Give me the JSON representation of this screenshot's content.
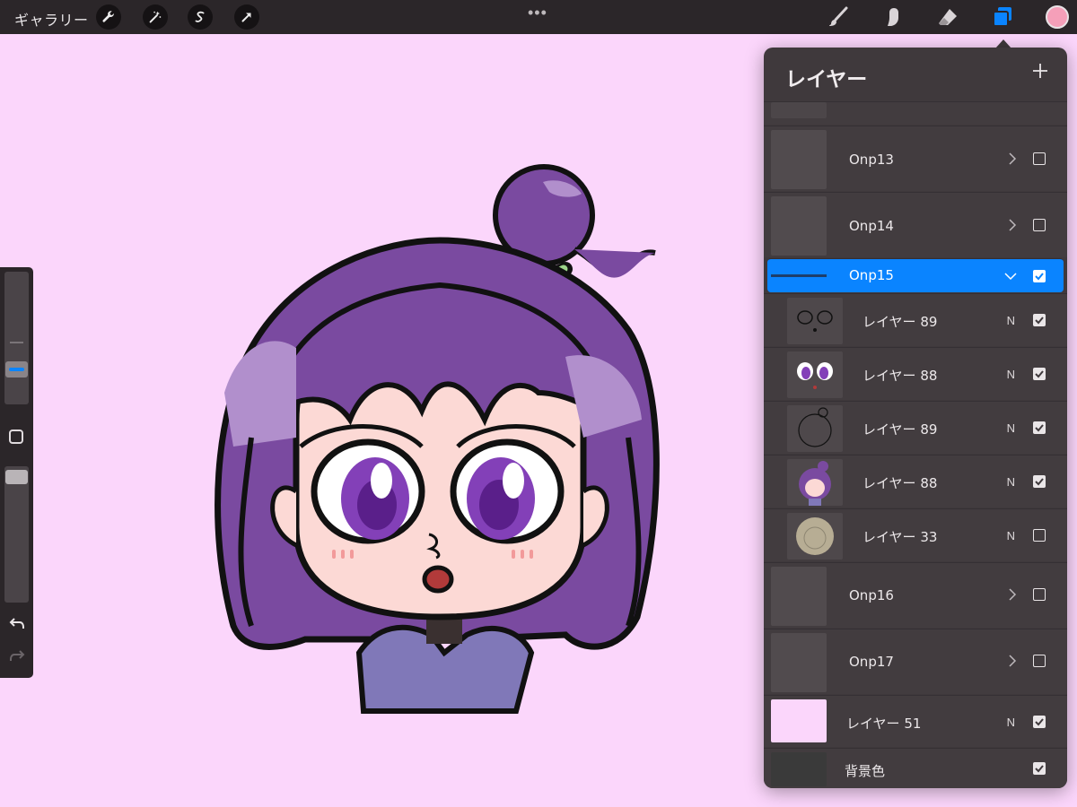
{
  "toolbar": {
    "gallery_label": "ギャラリー",
    "left_tools": [
      "wrench-icon",
      "magic-wand-icon",
      "selection-s-icon",
      "transform-arrow-icon"
    ],
    "more_dots": "•••",
    "right_tools": [
      "brush-icon",
      "smudge-icon",
      "eraser-icon",
      "layers-icon"
    ],
    "current_color": "#f59fb9"
  },
  "sidebar": {
    "brush_size_level": 0.45,
    "opacity_level": 0.95
  },
  "layers_panel": {
    "title": "レイヤー",
    "add_symbol": "+",
    "rows": [
      {
        "name": "Onp13",
        "type": "group",
        "collapsed": true,
        "visible": false
      },
      {
        "name": "Onp14",
        "type": "group",
        "collapsed": true,
        "visible": false
      },
      {
        "name": "Onp15",
        "type": "group",
        "collapsed": false,
        "selected": true,
        "visible": true
      },
      {
        "name": "レイヤー 89",
        "type": "layer",
        "mode": "N",
        "visible": true
      },
      {
        "name": "レイヤー 88",
        "type": "layer",
        "mode": "N",
        "visible": true
      },
      {
        "name": "レイヤー 89",
        "type": "layer",
        "mode": "N",
        "visible": true
      },
      {
        "name": "レイヤー 88",
        "type": "layer",
        "mode": "N",
        "visible": true
      },
      {
        "name": "レイヤー 33",
        "type": "layer",
        "mode": "N",
        "visible": false
      },
      {
        "name": "Onp16",
        "type": "group",
        "collapsed": true,
        "visible": false
      },
      {
        "name": "Onp17",
        "type": "group",
        "collapsed": true,
        "visible": false
      },
      {
        "name": "レイヤー 51",
        "type": "layer",
        "mode": "N",
        "visible": true
      },
      {
        "name": "背景色",
        "type": "background",
        "visible": true
      }
    ]
  },
  "colors": {
    "canvas_bg": "#fbd6fb",
    "accent": "#0a84ff",
    "hair": "#7a4aa0",
    "skin": "#fcd9d5",
    "shirt": "#8078b8"
  }
}
